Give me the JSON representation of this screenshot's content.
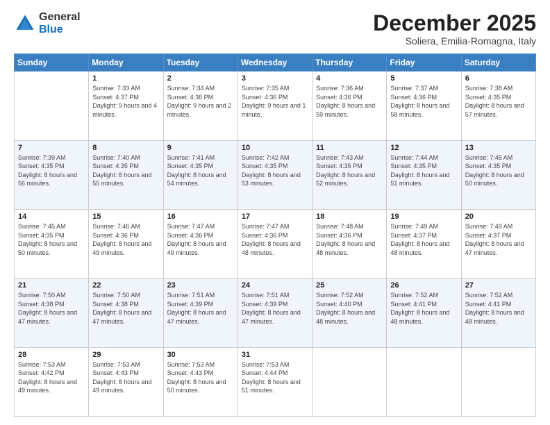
{
  "logo": {
    "general": "General",
    "blue": "Blue"
  },
  "header": {
    "month": "December 2025",
    "location": "Soliera, Emilia-Romagna, Italy"
  },
  "weekdays": [
    "Sunday",
    "Monday",
    "Tuesday",
    "Wednesday",
    "Thursday",
    "Friday",
    "Saturday"
  ],
  "weeks": [
    [
      {
        "day": "",
        "sunrise": "",
        "sunset": "",
        "daylight": ""
      },
      {
        "day": "1",
        "sunrise": "Sunrise: 7:33 AM",
        "sunset": "Sunset: 4:37 PM",
        "daylight": "Daylight: 9 hours and 4 minutes."
      },
      {
        "day": "2",
        "sunrise": "Sunrise: 7:34 AM",
        "sunset": "Sunset: 4:36 PM",
        "daylight": "Daylight: 9 hours and 2 minutes."
      },
      {
        "day": "3",
        "sunrise": "Sunrise: 7:35 AM",
        "sunset": "Sunset: 4:36 PM",
        "daylight": "Daylight: 9 hours and 1 minute."
      },
      {
        "day": "4",
        "sunrise": "Sunrise: 7:36 AM",
        "sunset": "Sunset: 4:36 PM",
        "daylight": "Daylight: 8 hours and 59 minutes."
      },
      {
        "day": "5",
        "sunrise": "Sunrise: 7:37 AM",
        "sunset": "Sunset: 4:36 PM",
        "daylight": "Daylight: 8 hours and 58 minutes."
      },
      {
        "day": "6",
        "sunrise": "Sunrise: 7:38 AM",
        "sunset": "Sunset: 4:35 PM",
        "daylight": "Daylight: 8 hours and 57 minutes."
      }
    ],
    [
      {
        "day": "7",
        "sunrise": "Sunrise: 7:39 AM",
        "sunset": "Sunset: 4:35 PM",
        "daylight": "Daylight: 8 hours and 56 minutes."
      },
      {
        "day": "8",
        "sunrise": "Sunrise: 7:40 AM",
        "sunset": "Sunset: 4:35 PM",
        "daylight": "Daylight: 8 hours and 55 minutes."
      },
      {
        "day": "9",
        "sunrise": "Sunrise: 7:41 AM",
        "sunset": "Sunset: 4:35 PM",
        "daylight": "Daylight: 8 hours and 54 minutes."
      },
      {
        "day": "10",
        "sunrise": "Sunrise: 7:42 AM",
        "sunset": "Sunset: 4:35 PM",
        "daylight": "Daylight: 8 hours and 53 minutes."
      },
      {
        "day": "11",
        "sunrise": "Sunrise: 7:43 AM",
        "sunset": "Sunset: 4:35 PM",
        "daylight": "Daylight: 8 hours and 52 minutes."
      },
      {
        "day": "12",
        "sunrise": "Sunrise: 7:44 AM",
        "sunset": "Sunset: 4:35 PM",
        "daylight": "Daylight: 8 hours and 51 minutes."
      },
      {
        "day": "13",
        "sunrise": "Sunrise: 7:45 AM",
        "sunset": "Sunset: 4:35 PM",
        "daylight": "Daylight: 8 hours and 50 minutes."
      }
    ],
    [
      {
        "day": "14",
        "sunrise": "Sunrise: 7:45 AM",
        "sunset": "Sunset: 4:35 PM",
        "daylight": "Daylight: 8 hours and 50 minutes."
      },
      {
        "day": "15",
        "sunrise": "Sunrise: 7:46 AM",
        "sunset": "Sunset: 4:36 PM",
        "daylight": "Daylight: 8 hours and 49 minutes."
      },
      {
        "day": "16",
        "sunrise": "Sunrise: 7:47 AM",
        "sunset": "Sunset: 4:36 PM",
        "daylight": "Daylight: 8 hours and 49 minutes."
      },
      {
        "day": "17",
        "sunrise": "Sunrise: 7:47 AM",
        "sunset": "Sunset: 4:36 PM",
        "daylight": "Daylight: 8 hours and 48 minutes."
      },
      {
        "day": "18",
        "sunrise": "Sunrise: 7:48 AM",
        "sunset": "Sunset: 4:36 PM",
        "daylight": "Daylight: 8 hours and 48 minutes."
      },
      {
        "day": "19",
        "sunrise": "Sunrise: 7:49 AM",
        "sunset": "Sunset: 4:37 PM",
        "daylight": "Daylight: 8 hours and 48 minutes."
      },
      {
        "day": "20",
        "sunrise": "Sunrise: 7:49 AM",
        "sunset": "Sunset: 4:37 PM",
        "daylight": "Daylight: 8 hours and 47 minutes."
      }
    ],
    [
      {
        "day": "21",
        "sunrise": "Sunrise: 7:50 AM",
        "sunset": "Sunset: 4:38 PM",
        "daylight": "Daylight: 8 hours and 47 minutes."
      },
      {
        "day": "22",
        "sunrise": "Sunrise: 7:50 AM",
        "sunset": "Sunset: 4:38 PM",
        "daylight": "Daylight: 8 hours and 47 minutes."
      },
      {
        "day": "23",
        "sunrise": "Sunrise: 7:51 AM",
        "sunset": "Sunset: 4:39 PM",
        "daylight": "Daylight: 8 hours and 47 minutes."
      },
      {
        "day": "24",
        "sunrise": "Sunrise: 7:51 AM",
        "sunset": "Sunset: 4:39 PM",
        "daylight": "Daylight: 8 hours and 47 minutes."
      },
      {
        "day": "25",
        "sunrise": "Sunrise: 7:52 AM",
        "sunset": "Sunset: 4:40 PM",
        "daylight": "Daylight: 8 hours and 48 minutes."
      },
      {
        "day": "26",
        "sunrise": "Sunrise: 7:52 AM",
        "sunset": "Sunset: 4:41 PM",
        "daylight": "Daylight: 8 hours and 48 minutes."
      },
      {
        "day": "27",
        "sunrise": "Sunrise: 7:52 AM",
        "sunset": "Sunset: 4:41 PM",
        "daylight": "Daylight: 8 hours and 48 minutes."
      }
    ],
    [
      {
        "day": "28",
        "sunrise": "Sunrise: 7:53 AM",
        "sunset": "Sunset: 4:42 PM",
        "daylight": "Daylight: 8 hours and 49 minutes."
      },
      {
        "day": "29",
        "sunrise": "Sunrise: 7:53 AM",
        "sunset": "Sunset: 4:43 PM",
        "daylight": "Daylight: 8 hours and 49 minutes."
      },
      {
        "day": "30",
        "sunrise": "Sunrise: 7:53 AM",
        "sunset": "Sunset: 4:43 PM",
        "daylight": "Daylight: 8 hours and 50 minutes."
      },
      {
        "day": "31",
        "sunrise": "Sunrise: 7:53 AM",
        "sunset": "Sunset: 4:44 PM",
        "daylight": "Daylight: 8 hours and 51 minutes."
      },
      {
        "day": "",
        "sunrise": "",
        "sunset": "",
        "daylight": ""
      },
      {
        "day": "",
        "sunrise": "",
        "sunset": "",
        "daylight": ""
      },
      {
        "day": "",
        "sunrise": "",
        "sunset": "",
        "daylight": ""
      }
    ]
  ]
}
